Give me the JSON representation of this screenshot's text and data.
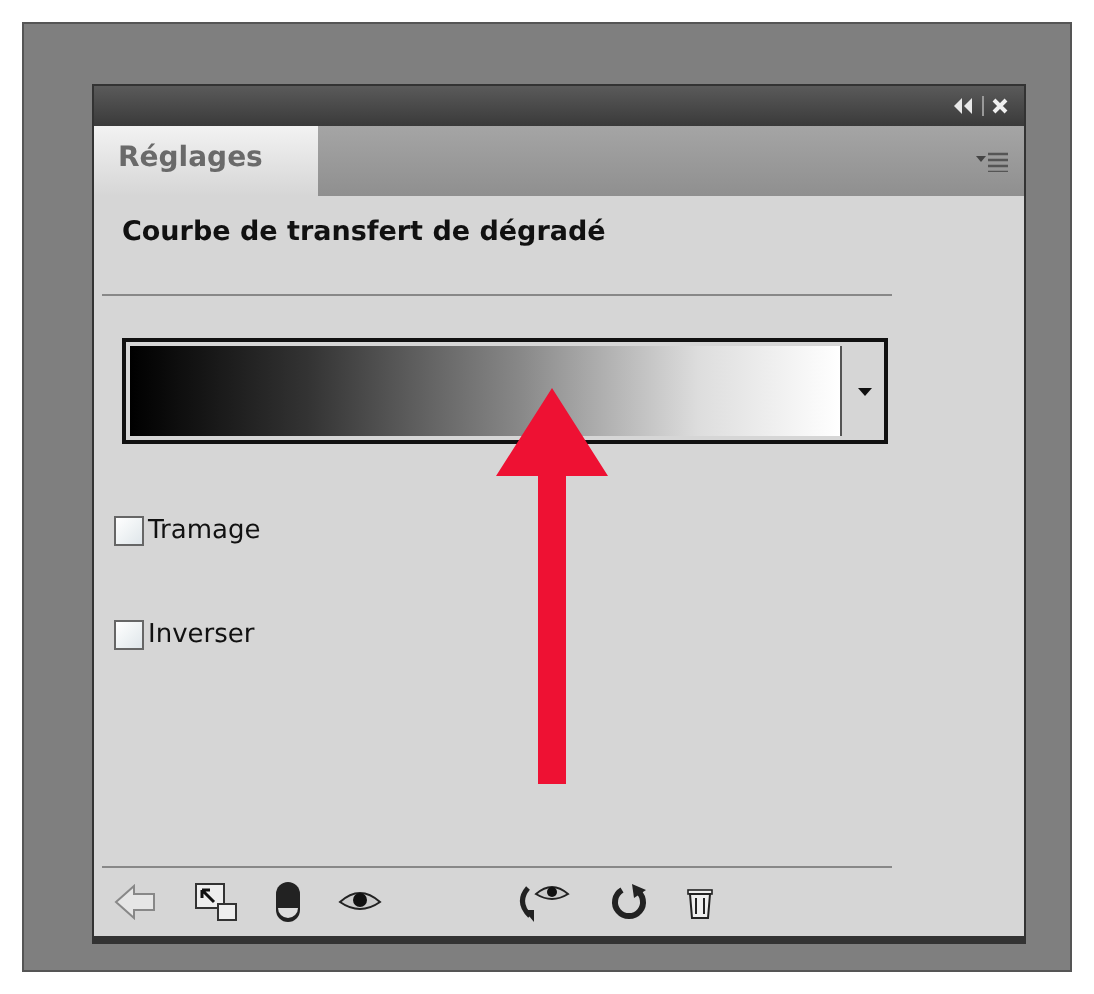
{
  "tabs": [
    {
      "label": "Réglages",
      "selected": true
    }
  ],
  "heading": "Courbe de transfert de dégradé",
  "options": [
    {
      "label": "Tramage",
      "checked": false
    },
    {
      "label": "Inverser",
      "checked": false
    }
  ]
}
